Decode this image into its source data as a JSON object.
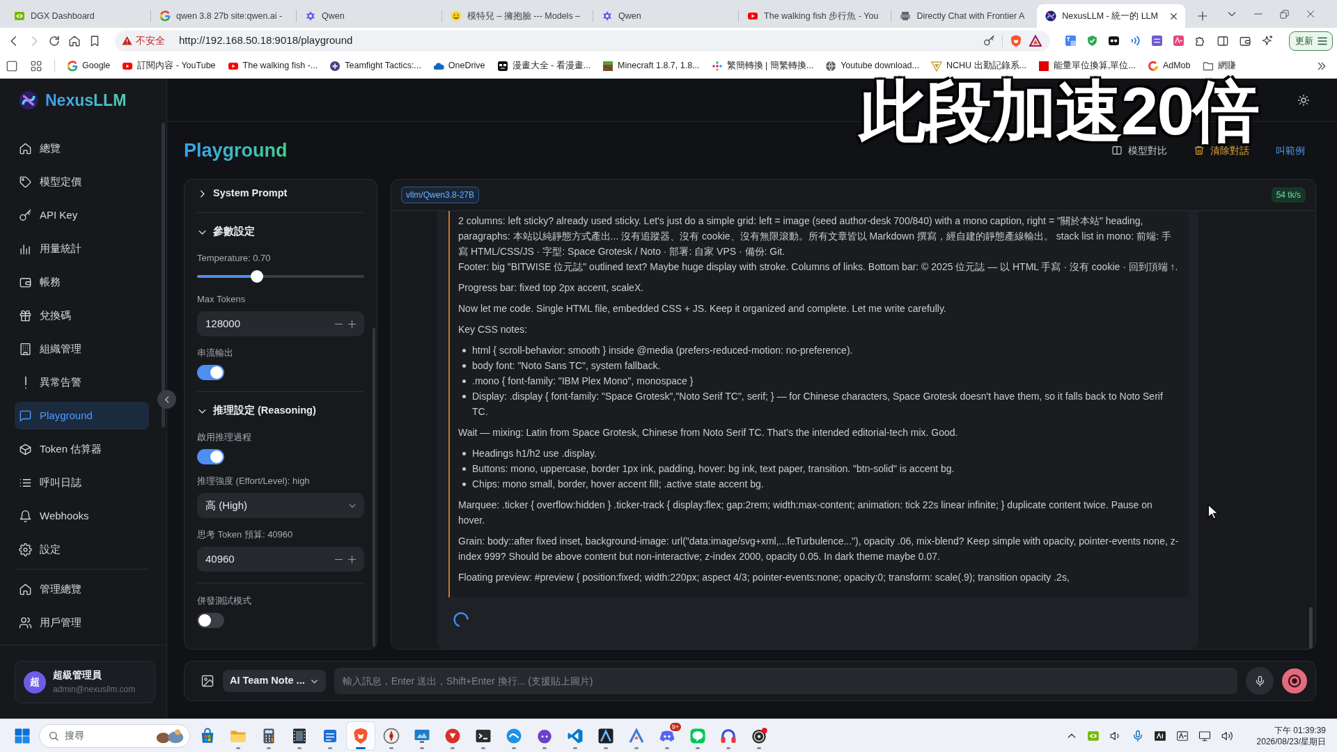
{
  "browser": {
    "tabs": [
      {
        "title": "DGX Dashboard",
        "selected": false
      },
      {
        "title": "qwen 3.8 27b site:qwen.ai -",
        "selected": false
      },
      {
        "title": "Qwen",
        "selected": false
      },
      {
        "title": "模特兒 – 擁抱臉 --- Models –",
        "selected": false
      },
      {
        "title": "Qwen",
        "selected": false
      },
      {
        "title": "The walking fish 步行魚 - You",
        "selected": false
      },
      {
        "title": "Directly Chat with Frontier A",
        "selected": false
      },
      {
        "title": "NexusLLM - 統一的 LLM",
        "selected": true
      }
    ],
    "forward_disabled": true,
    "security": "不安全",
    "url": "http://192.168.50.18:9018/playground",
    "update_button": "更新",
    "bookmarks": [
      "Google",
      "訂閱內容 - YouTube",
      "The walking fish -...",
      "Teamfight Tactics:...",
      "OneDrive",
      "漫畫大全 - 看漫畫...",
      "Minecraft 1.8.7, 1.8...",
      "繁簡轉換 | 簡繁轉換...",
      "Youtube download...",
      "NCHU 出勤記錄系...",
      "能量單位換算,單位...",
      "AdMob",
      "網賺"
    ]
  },
  "sidebar": {
    "brand": "NexusLLM",
    "items": [
      {
        "label": "總覽",
        "selected": false
      },
      {
        "label": "模型定價",
        "selected": false
      },
      {
        "label": "API Key",
        "selected": false
      },
      {
        "label": "用量統計",
        "selected": false
      },
      {
        "label": "帳務",
        "selected": false
      },
      {
        "label": "兌換碼",
        "selected": false
      },
      {
        "label": "組織管理",
        "selected": false
      },
      {
        "label": "異常告警",
        "selected": false
      },
      {
        "label": "Playground",
        "selected": true
      },
      {
        "label": "Token 估算器",
        "selected": false
      },
      {
        "label": "呼叫日誌",
        "selected": false
      },
      {
        "label": "Webhooks",
        "selected": false
      },
      {
        "label": "設定",
        "selected": false
      }
    ],
    "admin_items": [
      {
        "label": "管理總覽",
        "selected": false
      },
      {
        "label": "用戶管理",
        "selected": false
      }
    ],
    "user": {
      "avatar": "超",
      "name": "超級管理員",
      "email": "admin@nexusllm.com"
    }
  },
  "page": {
    "title": "Playground",
    "actions": [
      {
        "label": "模型對比",
        "kind": "neutral"
      },
      {
        "label": "清除對話",
        "kind": "warning"
      },
      {
        "label": "叫範例",
        "kind": "link"
      }
    ]
  },
  "overlay_caption": "此段加速20倍",
  "settings": {
    "sections": [
      {
        "title": "System Prompt",
        "expanded": false
      },
      {
        "title": "參數設定",
        "expanded": true,
        "controls": [
          {
            "kind": "slider",
            "label": "Temperature: 0.70",
            "level": 0.36
          },
          {
            "kind": "number",
            "label": "Max Tokens",
            "value": "128000"
          },
          {
            "kind": "toggle",
            "label": "串流輸出",
            "on": true
          }
        ]
      },
      {
        "title": "推理設定 (Reasoning)",
        "expanded": true,
        "controls": [
          {
            "kind": "toggle",
            "label": "啟用推理過程",
            "on": true
          },
          {
            "kind": "select",
            "label": "推理強度 (Effort/Level): high",
            "value": "高 (High)"
          },
          {
            "kind": "number",
            "label": "思考 Token 預算: 40960",
            "value": "40960"
          }
        ]
      },
      {
        "controls": [
          {
            "kind": "toggle",
            "label": "併發測試模式",
            "on": false
          }
        ]
      }
    ]
  },
  "chat": {
    "model": "vllm/Qwen3.8-27B",
    "speed": "54 tk/s",
    "loading": true,
    "reasoning": [
      {
        "kind": "paragraph",
        "text": "2 columns: left sticky? already used sticky. Let's just do a simple grid: left = image (seed author-desk 700/840) with a mono caption, right = \"關於本站\" heading, paragraphs: 本站以純靜態方式產出... 沒有追蹤器、沒有 cookie、沒有無限滾動。所有文章皆以 Markdown 撰寫，經自建的靜態產線輸出。 stack list in mono: 前端: 手寫 HTML/CSS/JS · 字型: Space Grotesk / Noto · 部署: 自家 VPS · 備份: Git.\nFooter: big \"BITWISE 位元誌\" outlined text? Maybe huge display with stroke. Columns of links. Bottom bar: © 2025 位元誌 — 以 HTML 手寫 · 沒有 cookie · 回到頂端 ↑."
      },
      {
        "kind": "paragraph",
        "text": "Progress bar: fixed top 2px accent, scaleX."
      },
      {
        "kind": "paragraph",
        "text": "Now let me code. Single HTML file, embedded CSS + JS. Keep it organized and complete. Let me write carefully."
      },
      {
        "kind": "paragraph",
        "text": "Key CSS notes:"
      },
      {
        "kind": "list",
        "items": [
          "html { scroll-behavior: smooth } inside @media (prefers-reduced-motion: no-preference).",
          "body font: \"Noto Sans TC\", system fallback.",
          ".mono { font-family: \"IBM Plex Mono\", monospace }",
          "Display: .display { font-family: \"Space Grotesk\",\"Noto Serif TC\", serif; } — for Chinese characters, Space Grotesk doesn't have them, so it falls back to Noto Serif TC."
        ]
      },
      {
        "kind": "paragraph",
        "text": "Wait — mixing: Latin from Space Grotesk, Chinese from Noto Serif TC. That's the intended editorial-tech mix. Good."
      },
      {
        "kind": "list",
        "items": [
          "Headings h1/h2 use .display.",
          "Buttons: mono, uppercase, border 1px ink, padding, hover: bg ink, text paper, transition. \"btn-solid\" is accent bg.",
          "Chips: mono small, border, hover accent fill; .active state accent bg."
        ]
      },
      {
        "kind": "paragraph",
        "text": "Marquee: .ticker { overflow:hidden } .ticker-track { display:flex; gap:2rem; width:max-content; animation: tick 22s linear infinite; } duplicate content twice. Pause on hover."
      },
      {
        "kind": "paragraph",
        "text": "Grain: body::after fixed inset, background-image: url(\"data:image/svg+xml,...feTurbulence...\"), opacity .06, mix-blend? Keep simple with opacity, pointer-events none, z-index 999? Should be above content but non-interactive; z-index 2000, opacity 0.05. In dark theme maybe 0.07."
      },
      {
        "kind": "paragraph",
        "text": "Floating preview: #preview { position:fixed; width:220px; aspect 4/3; pointer-events:none; opacity:0; transform: scale(.9); transition opacity .2s,"
      }
    ]
  },
  "composer": {
    "agent": "AI Team Note ...",
    "placeholder": "輸入訊息，Enter 送出，Shift+Enter 換行... (支援貼上圖片)"
  },
  "taskbar": {
    "search": "搜尋",
    "apps": [
      {
        "selected": false,
        "running": false
      },
      {
        "selected": false,
        "running": true
      },
      {
        "selected": false,
        "running": true
      },
      {
        "selected": false,
        "running": true
      },
      {
        "selected": false,
        "running": true
      },
      {
        "selected": true,
        "running": true
      },
      {
        "selected": false,
        "running": true
      },
      {
        "selected": false,
        "running": true
      },
      {
        "selected": false,
        "running": true
      },
      {
        "selected": false,
        "running": true
      },
      {
        "selected": false,
        "running": true
      },
      {
        "selected": false,
        "running": true
      },
      {
        "selected": false,
        "running": true
      },
      {
        "selected": false,
        "running": true
      },
      {
        "selected": false,
        "running": true
      },
      {
        "selected": false,
        "running": true,
        "badge": "9+"
      },
      {
        "selected": false,
        "running": true
      },
      {
        "selected": false,
        "running": true
      },
      {
        "selected": false,
        "running": true
      }
    ],
    "clock": {
      "time": "下午 01:39:39",
      "date": "2026/08/23/星期日"
    }
  }
}
